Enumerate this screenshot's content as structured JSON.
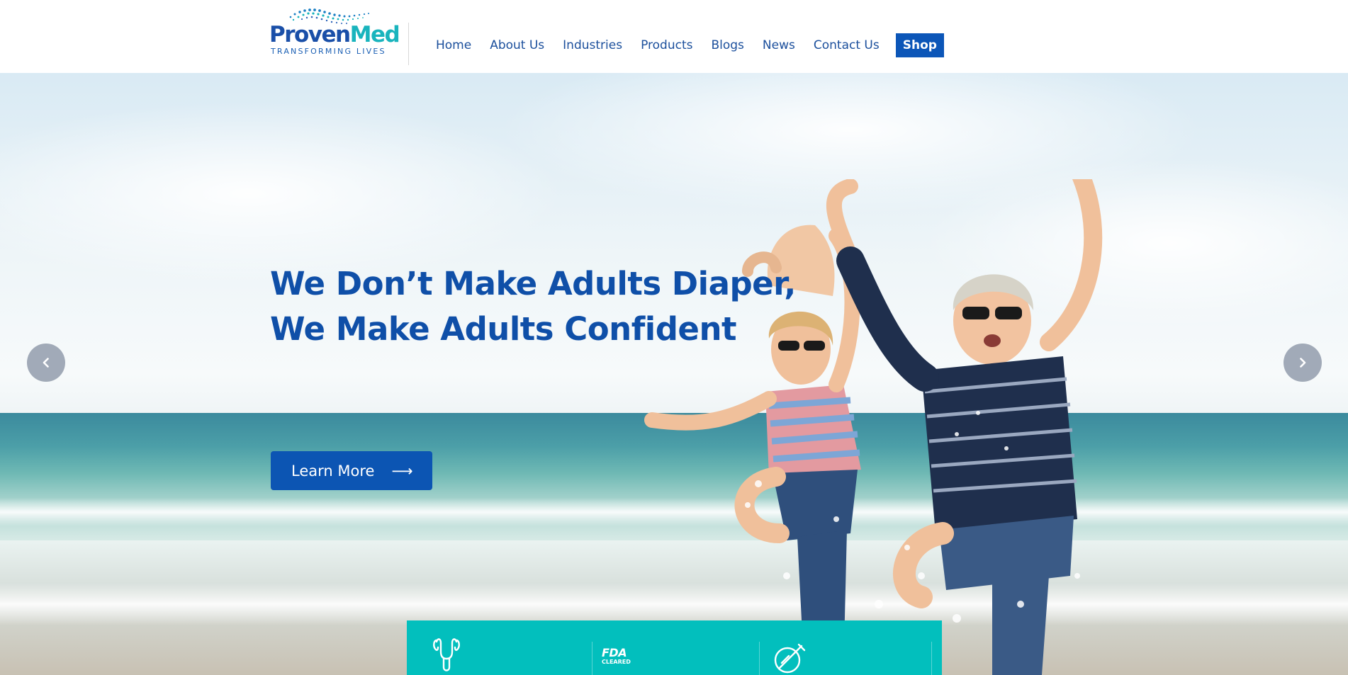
{
  "logo": {
    "word_part1": "Proven",
    "word_part2": "Med",
    "tagline": "TRANSFORMING LIVES"
  },
  "nav": {
    "items": [
      "Home",
      "About Us",
      "Industries",
      "Products",
      "Blogs",
      "News",
      "Contact Us"
    ],
    "shop_label": "Shop"
  },
  "hero": {
    "headline_line1": "We Don’t Make Adults Diaper,",
    "headline_line2": "We Make Adults Confident",
    "cta_label": "Learn More",
    "cta_arrow": "⟶"
  },
  "carousel": {
    "prev_icon": "chevron-left-icon",
    "next_icon": "chevron-right-icon"
  },
  "features": {
    "icons": [
      "uterus-icon",
      "fda-cleared-icon",
      "no-needle-icon"
    ],
    "fda_text_top": "FDA",
    "fda_text_bottom": "CLEARED"
  },
  "colors": {
    "brand_blue": "#0c55b3",
    "brand_teal": "#02bfbd",
    "nav_text": "#1b4f9c",
    "headline": "#0f4fa8"
  }
}
